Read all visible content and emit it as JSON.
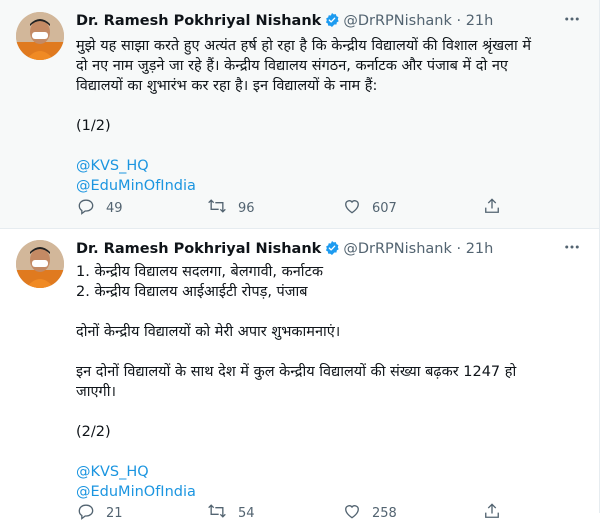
{
  "tweets": [
    {
      "author_name": "Dr. Ramesh Pokhriyal Nishank",
      "handle": "@DrRPNishank",
      "separator": "·",
      "time": "21h",
      "more_icon": "more-horizontal-icon",
      "text_lines": [
        "मुझे यह साझा करते हुए अत्यंत हर्ष हो रहा है कि केन्द्रीय विद्यालयों की विशाल श्रृंखला में",
        "दो नए नाम जुड़ने जा रहे हैं। केन्द्रीय विद्यालय संगठन, कर्नाटक और पंजाब में दो नए",
        "विद्यालयों का शुभारंभ कर रहा है। इन विद्यालयों के नाम हैं:"
      ],
      "counter": "(1/2)",
      "mentions": [
        "@KVS_HQ",
        "@EduMinOfIndia"
      ],
      "replies": "49",
      "retweets": "96",
      "likes": "607"
    },
    {
      "author_name": "Dr. Ramesh Pokhriyal Nishank",
      "handle": "@DrRPNishank",
      "separator": "·",
      "time": "21h",
      "more_icon": "more-horizontal-icon",
      "list_lines": [
        "1. केन्द्रीय विद्यालय सदलगा, बेलगावी, कर्नाटक",
        "2. केन्द्रीय विद्यालय आईआईटी रोपड़, पंजाब"
      ],
      "wish_line": "दोनों केन्द्रीय विद्यालयों को मेरी अपार शुभकामनाएं।",
      "count_lines": [
        "इन दोनों विद्यालयों के साथ देश में कुल केन्द्रीय विद्यालयों की संख्या बढ़कर 1247 हो",
        "जाएगी।"
      ],
      "counter": "(2/2)",
      "mentions": [
        "@KVS_HQ",
        "@EduMinOfIndia"
      ],
      "replies": "21",
      "retweets": "54",
      "likes": "258"
    }
  ],
  "colors": {
    "link": "#1b95e0",
    "verified": "#1d9bf0",
    "muted": "#536471",
    "highlight_bg": "#f7f9f9"
  }
}
